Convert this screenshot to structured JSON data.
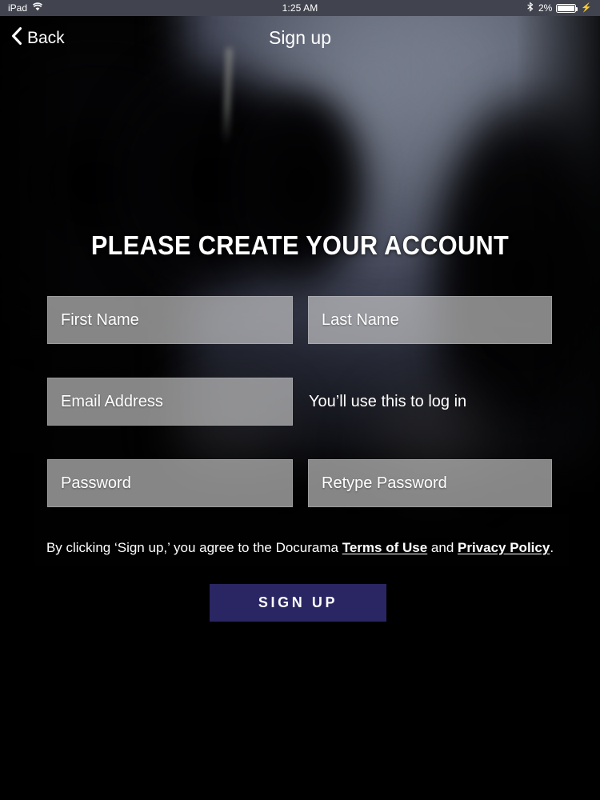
{
  "status_bar": {
    "device_label": "iPad",
    "wifi_icon": "wifi-icon",
    "time": "1:25 AM",
    "bluetooth_icon": "bluetooth-icon",
    "battery_percent": "2%",
    "battery_icon": "battery-charging-icon",
    "charging_bolt": "⚡"
  },
  "nav_bar": {
    "back_icon": "chevron-left-icon",
    "back_label": "Back",
    "title": "Sign up"
  },
  "main": {
    "headline": "PLEASE CREATE YOUR ACCOUNT",
    "fields": [
      {
        "name": "first-name",
        "placeholder": "First Name",
        "value": ""
      },
      {
        "name": "last-name",
        "placeholder": "Last Name",
        "value": ""
      },
      {
        "name": "email-address",
        "placeholder": "Email Address",
        "value": ""
      },
      {
        "name": "password",
        "placeholder": "Password",
        "value": ""
      },
      {
        "name": "retype-password",
        "placeholder": "Retype Password",
        "value": ""
      }
    ],
    "email_hint": "You’ll use this to log in",
    "terms": {
      "prefix": "By clicking ‘Sign up,’ you agree to the Docurama ",
      "terms_link": "Terms of Use",
      "middle": " and ",
      "privacy_link": "Privacy Policy",
      "suffix": "."
    },
    "signup_button": "SIGN UP"
  },
  "colors": {
    "status_bar_bg": "#41444f",
    "signup_button_bg": "#2a2663",
    "field_bg": "#d8d8d8",
    "text_primary": "#ffffff",
    "page_bg": "#000000"
  }
}
